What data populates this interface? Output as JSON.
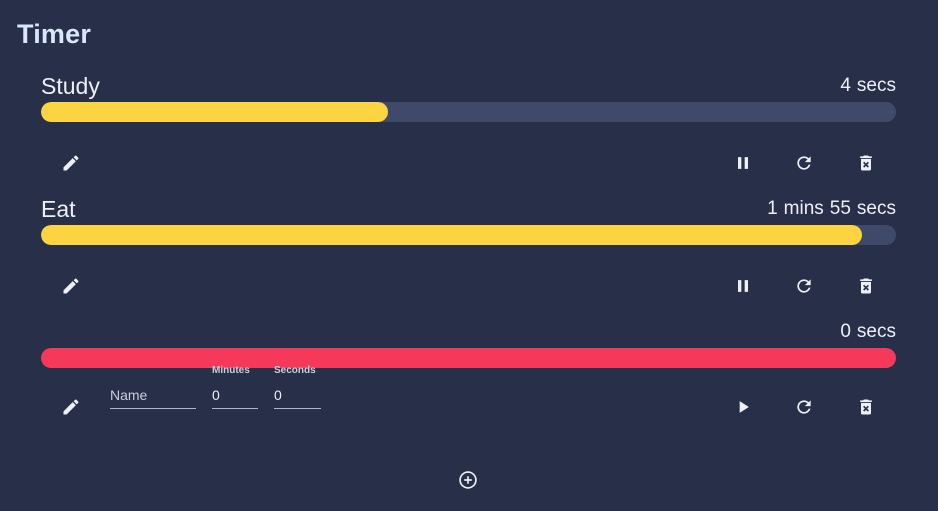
{
  "app": {
    "title": "Timer"
  },
  "timers": [
    {
      "name": "Study",
      "time_parts": [
        "4",
        "secs"
      ],
      "progress": 0.406,
      "state": "running",
      "primary_action_icon": "pause-icon"
    },
    {
      "name": "Eat",
      "time_parts": [
        "1",
        "mins",
        "55",
        "secs"
      ],
      "progress": 0.96,
      "state": "running",
      "primary_action_icon": "pause-icon"
    },
    {
      "name": "",
      "time_parts": [
        "0",
        "secs"
      ],
      "progress": 1.0,
      "state": "finished",
      "primary_action_icon": "play-icon",
      "form": {
        "name_placeholder": "Name",
        "name_value": "",
        "minutes_label": "Minutes",
        "minutes_value": "0",
        "seconds_label": "Seconds",
        "seconds_value": "0"
      }
    }
  ],
  "colors": {
    "background": "#282f48",
    "track": "#3f4a6a",
    "progress_running": "#fcd340",
    "progress_finished": "#f6395a",
    "title": "#d9e6ff"
  },
  "add_button_icon": "add-circle-icon"
}
